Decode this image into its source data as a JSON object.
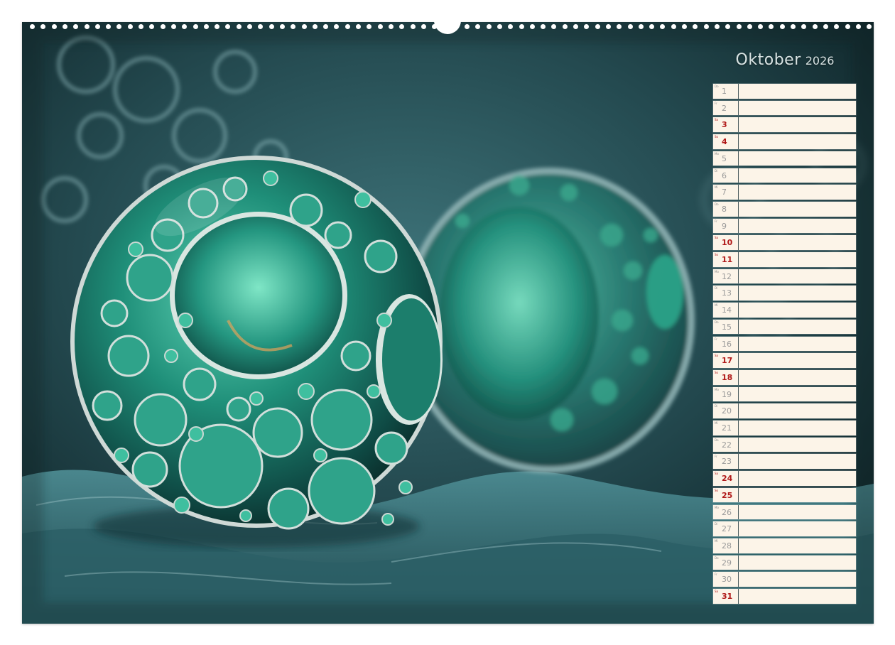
{
  "calendar": {
    "month": "Oktober",
    "year": "2026"
  },
  "days": [
    {
      "num": "1",
      "wd": "Do",
      "weekend": false
    },
    {
      "num": "2",
      "wd": "Fr",
      "weekend": false
    },
    {
      "num": "3",
      "wd": "Sa",
      "weekend": true
    },
    {
      "num": "4",
      "wd": "So",
      "weekend": true
    },
    {
      "num": "5",
      "wd": "Mo",
      "weekend": false
    },
    {
      "num": "6",
      "wd": "Di",
      "weekend": false
    },
    {
      "num": "7",
      "wd": "Mi",
      "weekend": false
    },
    {
      "num": "8",
      "wd": "Do",
      "weekend": false
    },
    {
      "num": "9",
      "wd": "Fr",
      "weekend": false
    },
    {
      "num": "10",
      "wd": "Sa",
      "weekend": true
    },
    {
      "num": "11",
      "wd": "So",
      "weekend": true
    },
    {
      "num": "12",
      "wd": "Mo",
      "weekend": false
    },
    {
      "num": "13",
      "wd": "Di",
      "weekend": false
    },
    {
      "num": "14",
      "wd": "Mi",
      "weekend": false
    },
    {
      "num": "15",
      "wd": "Do",
      "weekend": false
    },
    {
      "num": "16",
      "wd": "Fr",
      "weekend": false
    },
    {
      "num": "17",
      "wd": "Sa",
      "weekend": true
    },
    {
      "num": "18",
      "wd": "So",
      "weekend": true
    },
    {
      "num": "19",
      "wd": "Mo",
      "weekend": false
    },
    {
      "num": "20",
      "wd": "Di",
      "weekend": false
    },
    {
      "num": "21",
      "wd": "Mi",
      "weekend": false
    },
    {
      "num": "22",
      "wd": "Do",
      "weekend": false
    },
    {
      "num": "23",
      "wd": "Fr",
      "weekend": false
    },
    {
      "num": "24",
      "wd": "Sa",
      "weekend": true
    },
    {
      "num": "25",
      "wd": "So",
      "weekend": true
    },
    {
      "num": "26",
      "wd": "Mo",
      "weekend": false
    },
    {
      "num": "27",
      "wd": "Di",
      "weekend": false
    },
    {
      "num": "28",
      "wd": "Mi",
      "weekend": false
    },
    {
      "num": "29",
      "wd": "Do",
      "weekend": false
    },
    {
      "num": "30",
      "wd": "Fr",
      "weekend": false
    },
    {
      "num": "31",
      "wd": "Sa",
      "weekend": true
    }
  ],
  "colors": {
    "teal": "#1f8f79",
    "deep_teal": "#152e33",
    "cream": "#fcf4e8",
    "weekend_red": "#b01818"
  }
}
